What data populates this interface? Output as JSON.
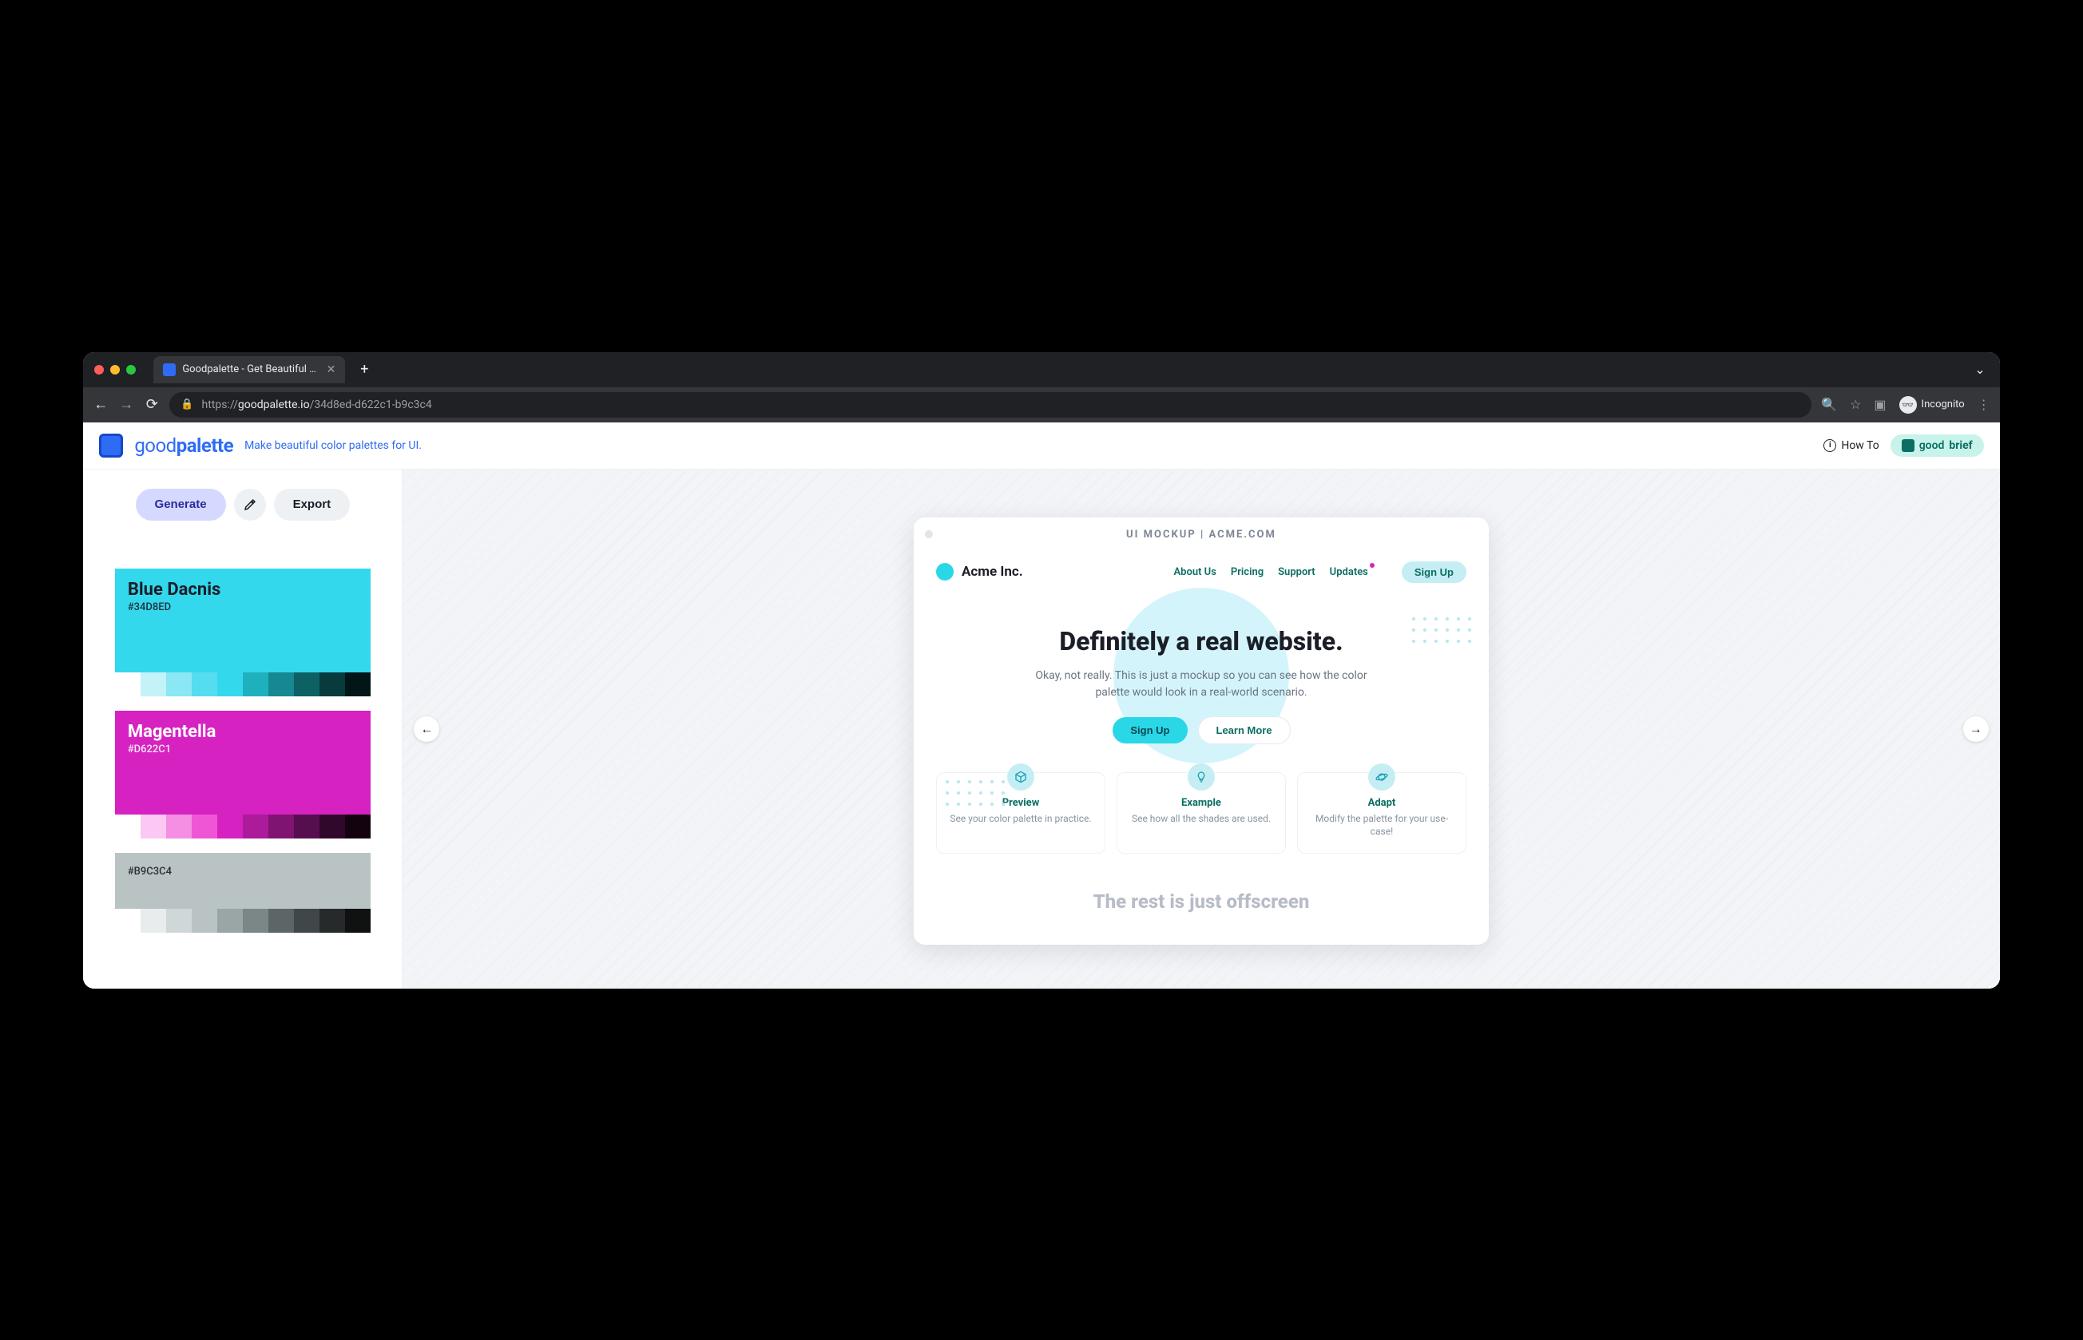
{
  "browser": {
    "tab_title": "Goodpalette - Get Beautiful Co",
    "url_scheme": "https://",
    "url_host": "goodpalette.io",
    "url_path": "/34d8ed-d622c1-b9c3c4",
    "incognito_label": "Incognito"
  },
  "header": {
    "logo_word1": "good",
    "logo_word2": "palette",
    "tagline": "Make beautiful color palettes for UI.",
    "howto_label": "How To",
    "goodbrief_word1": "good",
    "goodbrief_word2": "brief"
  },
  "actions": {
    "generate": "Generate",
    "eyedropper_icon": "eyedropper",
    "export": "Export"
  },
  "palettes": [
    {
      "name": "Blue Dacnis",
      "hex": "#34D8ED",
      "main_color": "#34d8ed",
      "light_text": false,
      "shades": [
        "#ffffff",
        "#c3f2f9",
        "#8be7f4",
        "#55dcf0",
        "#34d8ed",
        "#1fb0be",
        "#158891",
        "#0d6165",
        "#073b3c",
        "#021617"
      ]
    },
    {
      "name": "Magentella",
      "hex": "#D622C1",
      "main_color": "#d622c1",
      "light_text": true,
      "shades": [
        "#ffffff",
        "#fac8f2",
        "#f48fe4",
        "#ee56d6",
        "#d622c1",
        "#ab1b9a",
        "#801473",
        "#570e4e",
        "#30082b",
        "#13030f"
      ]
    },
    {
      "name": "",
      "hex": "#B9C3C4",
      "main_color": "#b9c3c4",
      "light_text": false,
      "shades": [
        "#ffffff",
        "#e8ecec",
        "#d0d7d8",
        "#b9c3c4",
        "#9aa5a6",
        "#7b8687",
        "#5d6667",
        "#404748",
        "#262a2b",
        "#101111"
      ]
    }
  ],
  "mockup": {
    "title": "UI MOCKUP | ACME.COM",
    "brand": "Acme Inc.",
    "nav": [
      "About Us",
      "Pricing",
      "Support",
      "Updates"
    ],
    "nav_badge_index": 3,
    "signup": "Sign Up",
    "hero_headline": "Definitely a real website.",
    "hero_sub": "Okay, not really. This is just a mockup so you can see how the color palette would look in a real-world scenario.",
    "hero_primary": "Sign Up",
    "hero_secondary": "Learn More",
    "features": [
      {
        "icon": "cube",
        "title": "Preview",
        "desc": "See your color palette in practice."
      },
      {
        "icon": "bulb",
        "title": "Example",
        "desc": "See how all the shades are used."
      },
      {
        "icon": "planet",
        "title": "Adapt",
        "desc": "Modify the palette for your use-case!"
      }
    ],
    "offscreen": "The rest is just offscreen"
  }
}
